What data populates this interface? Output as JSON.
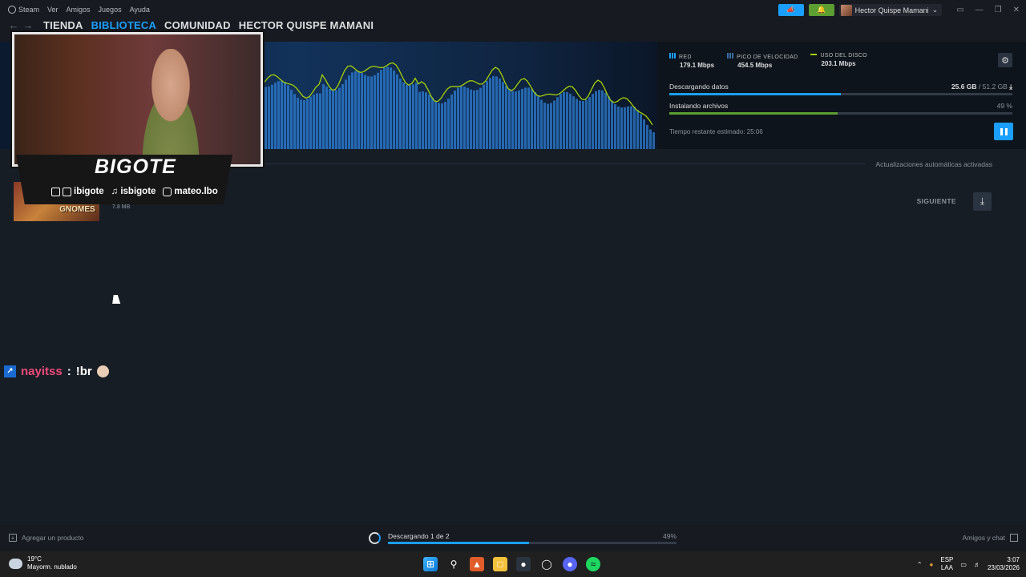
{
  "menu": {
    "steam": "Steam",
    "items": [
      "Ver",
      "Amigos",
      "Juegos",
      "Ayuda"
    ]
  },
  "nav": {
    "tabs": [
      "TIENDA",
      "BIBLIOTECA",
      "COMUNIDAD",
      "HECTOR QUISPE MAMANI"
    ]
  },
  "user": {
    "name": "Hector Quispe Mamani"
  },
  "stats": {
    "red_label": "RED",
    "red_value": "179.1 Mbps",
    "peak_label": "PICO DE VELOCIDAD",
    "peak_value": "454.5 Mbps",
    "disk_label": "USO DEL DISCO",
    "disk_value": "203.1 Mbps"
  },
  "download": {
    "data_label": "Descargando datos",
    "data_done": "25.6 GB",
    "data_total": "/ 51.2 GB",
    "data_fraction": 0.5,
    "install_label": "Instalando archivos",
    "install_pct": "49 %",
    "install_fraction": 0.49,
    "eta": "Tiempo restante estimado: 25:06"
  },
  "auto_updates": "Actualizaciones automáticas activadas",
  "queue": {
    "game_title": "BURGLIN' GNOMES",
    "size": "7.8 MB",
    "next_label": "SIGUIENTE"
  },
  "overlay": {
    "brand": "BIGOTE",
    "socials": [
      "ibigote",
      "isbigote",
      "mateo.lbo"
    ]
  },
  "chat": {
    "user": "nayitss",
    "sep": ":",
    "message": "!br"
  },
  "footer": {
    "add_product": "Agregar un producto",
    "status": "Descargando 1 de 2",
    "pct": "49%",
    "progress": 0.49,
    "friends": "Amigos y chat"
  },
  "taskbar": {
    "temp": "19°C",
    "weather": "Mayorm. nublado",
    "lang1": "ESP",
    "lang2": "LAA",
    "time": "3:07",
    "date": "23/03/2026"
  },
  "colors": {
    "accent": "#1a9fff",
    "green": "#5c9e31",
    "bg": "#171d25"
  }
}
